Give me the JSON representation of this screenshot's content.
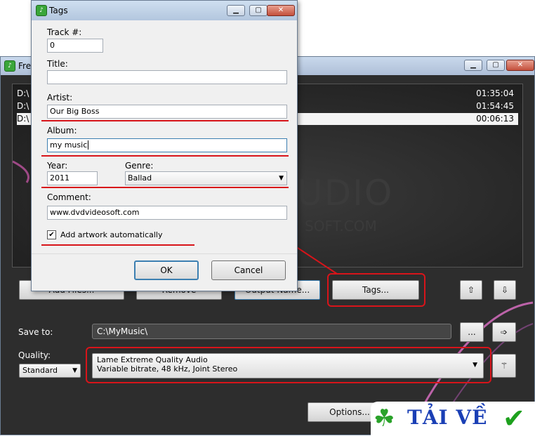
{
  "main_window": {
    "title": "Free",
    "files": [
      {
        "path": "D:\\",
        "duration": "01:35:04"
      },
      {
        "path": "D:\\",
        "duration": "01:54:45"
      },
      {
        "path": "D:\\",
        "duration": "00:06:13"
      }
    ],
    "watermark_big": "UDIO",
    "watermark_small": "SOFT.COM",
    "buttons": {
      "add_files": "Add Files...",
      "remove": "Remove",
      "output_name": "Output Name...",
      "tags": "Tags...",
      "browse": "...",
      "options": "Options..."
    },
    "save_to": {
      "label": "Save to:",
      "value": "C:\\MyMusic\\"
    },
    "quality": {
      "label": "Quality:",
      "preset": "Standard",
      "profile_line1": "Lame Extreme Quality Audio",
      "profile_line2": "Variable bitrate, 48 kHz, Joint Stereo"
    }
  },
  "tags_dialog": {
    "title": "Tags",
    "track_label": "Track #:",
    "track_value": "0",
    "title_label": "Title:",
    "title_value": "",
    "artist_label": "Artist:",
    "artist_value": "Our Big Boss",
    "album_label": "Album:",
    "album_value": "my music",
    "year_label": "Year:",
    "year_value": "2011",
    "genre_label": "Genre:",
    "genre_value": "Ballad",
    "comment_label": "Comment:",
    "comment_value": "www.dvdvideosoft.com",
    "artwork_label": "Add artwork automatically",
    "artwork_checked": true,
    "ok_label": "OK",
    "cancel_label": "Cancel"
  },
  "banner": {
    "text": "TẢI VỀ"
  },
  "colors": {
    "annotation_red": "#d8141a",
    "accent_blue": "#3c7fb1"
  }
}
